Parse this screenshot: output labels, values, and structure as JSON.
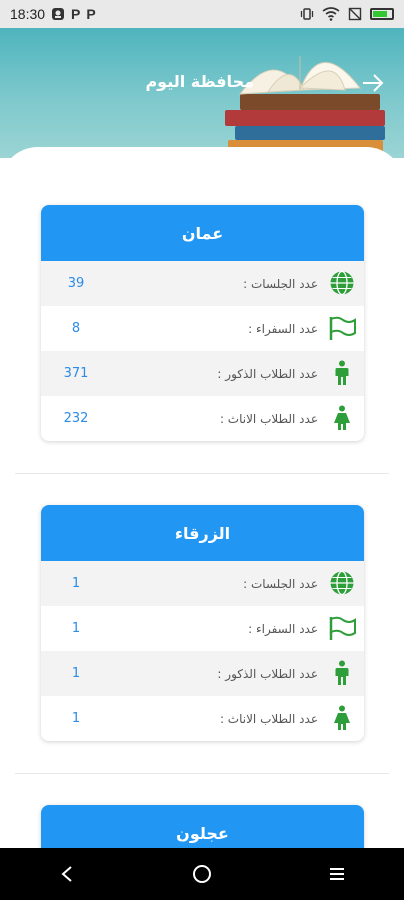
{
  "status_bar": {
    "time": "18:30",
    "icons_left": [
      "shield-icon",
      "p-notification-icon",
      "p-notification-icon"
    ],
    "icons_right": [
      "vibrate-icon",
      "wifi-icon",
      "mute-icon",
      "battery-icon"
    ],
    "p_letter": "P"
  },
  "header": {
    "title": "محافظة اليوم",
    "back_icon": "arrow-right-icon"
  },
  "colors": {
    "accent": "#2196f3",
    "value": "#2b8be6",
    "icon_green": "#2e9e3a"
  },
  "cards": [
    {
      "name": "عمان",
      "rows": [
        {
          "icon": "globe-icon",
          "label": "عدد الجلسات :",
          "value": "39"
        },
        {
          "icon": "flag-icon",
          "label": "عدد السفراء :",
          "value": "8"
        },
        {
          "icon": "male-icon",
          "label": "عدد الطلاب الذكور :",
          "value": "371"
        },
        {
          "icon": "female-icon",
          "label": "عدد الطلاب الاناث :",
          "value": "232"
        }
      ]
    },
    {
      "name": "الزرقاء",
      "rows": [
        {
          "icon": "globe-icon",
          "label": "عدد الجلسات :",
          "value": "1"
        },
        {
          "icon": "flag-icon",
          "label": "عدد السفراء :",
          "value": "1"
        },
        {
          "icon": "male-icon",
          "label": "عدد الطلاب الذكور :",
          "value": "1"
        },
        {
          "icon": "female-icon",
          "label": "عدد الطلاب الاناث :",
          "value": "1"
        }
      ]
    },
    {
      "name": "عجلون",
      "rows": []
    }
  ],
  "nav": {
    "back": "back-nav-icon",
    "home": "home-nav-icon",
    "recents": "recents-nav-icon"
  }
}
